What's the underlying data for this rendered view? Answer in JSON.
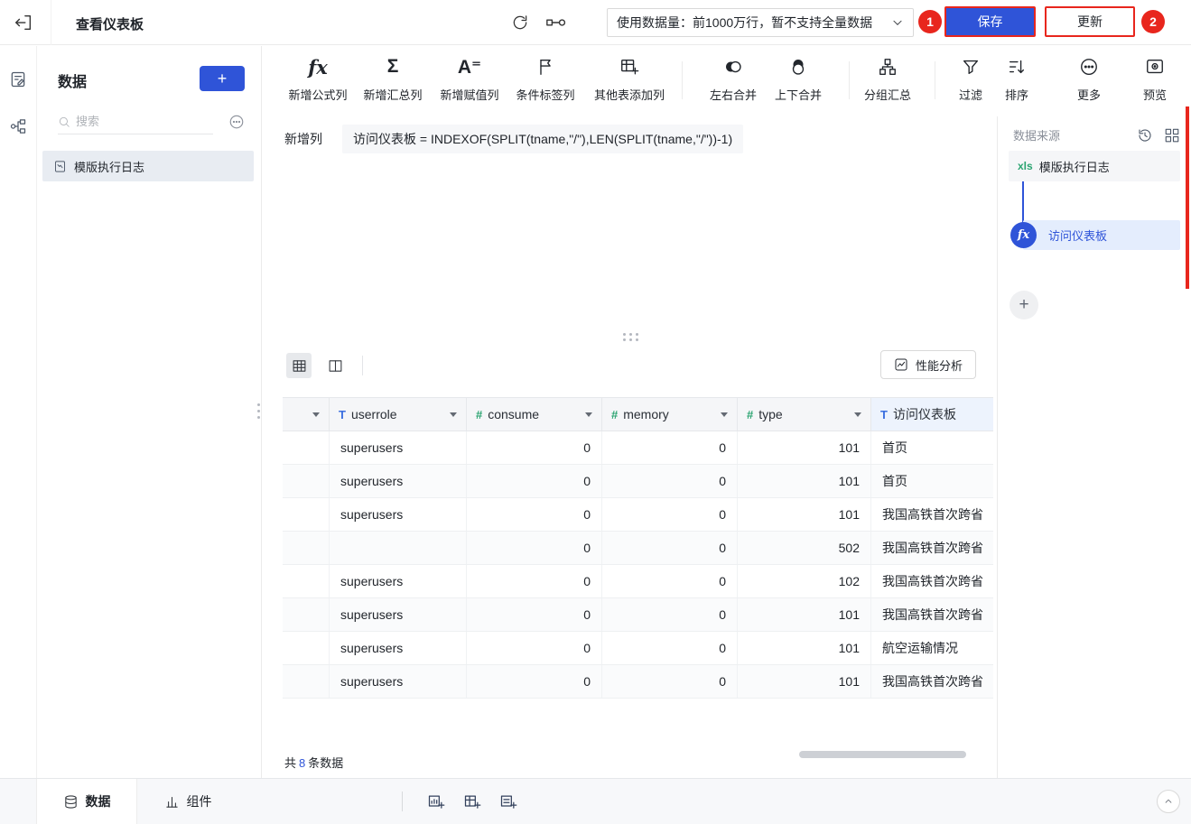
{
  "topbar": {
    "exit_icon": "exit-icon",
    "title": "查看仪表板",
    "refresh_icon": "refresh-icon",
    "flow_icon": "flow-icon",
    "data_limit_label": "使用数据量：前1000万行，暂不支持全量数据",
    "save_label": "保存",
    "update_label": "更新",
    "annotation_badge_1": "1",
    "annotation_badge_2": "2"
  },
  "left_rail": {
    "icons": [
      "data-edit-icon",
      "relation-icon"
    ]
  },
  "left_panel": {
    "title": "数据",
    "add_button": "+",
    "search_placeholder": "搜索",
    "more_icon": "ellipsis-circle-icon",
    "list": [
      {
        "icon": "log-table-icon",
        "label": "模版执行日志"
      }
    ]
  },
  "toolbar": {
    "items": [
      {
        "icon": "formula-icon",
        "glyph": "fx",
        "label": "新增公式列"
      },
      {
        "icon": "sigma-icon",
        "glyph": "Σ",
        "label": "新增汇总列"
      },
      {
        "icon": "assign-icon",
        "glyph": "A⁼",
        "label": "新增赋值列"
      },
      {
        "icon": "flag-icon",
        "label": "条件标签列"
      },
      {
        "icon": "table-add-icon",
        "label": "其他表添加列"
      },
      {
        "icon": "merge-horizontal-icon",
        "label": "左右合并"
      },
      {
        "icon": "merge-vertical-icon",
        "label": "上下合并"
      },
      {
        "icon": "group-summary-icon",
        "label": "分组汇总"
      },
      {
        "icon": "filter-icon",
        "label": "过滤"
      },
      {
        "icon": "sort-icon",
        "label": "排序"
      },
      {
        "icon": "more-icon",
        "label": "更多"
      },
      {
        "icon": "preview-icon",
        "label": "预览"
      }
    ]
  },
  "formula_bar": {
    "label": "新增列",
    "expression": "访问仪表板 = INDEXOF(SPLIT(tname,\"/\"),LEN(SPLIT(tname,\"/\"))-1)"
  },
  "table_section": {
    "view_icons": [
      "grid-view-icon",
      "column-view-icon"
    ],
    "performance_label": "性能分析",
    "type_icons": {
      "text": "T",
      "number": "#"
    },
    "columns": [
      {
        "name": "",
        "type": ""
      },
      {
        "name": "userrole",
        "type": "text"
      },
      {
        "name": "consume",
        "type": "number"
      },
      {
        "name": "memory",
        "type": "number"
      },
      {
        "name": "type",
        "type": "number"
      },
      {
        "name": "访问仪表板",
        "type": "text"
      }
    ],
    "rows": [
      {
        "userrole": "superusers",
        "consume": "0",
        "memory": "0",
        "type": "101",
        "dashboard": "首页"
      },
      {
        "userrole": "superusers",
        "consume": "0",
        "memory": "0",
        "type": "101",
        "dashboard": "首页"
      },
      {
        "userrole": "superusers",
        "consume": "0",
        "memory": "0",
        "type": "101",
        "dashboard": "我国高铁首次跨省"
      },
      {
        "userrole": "",
        "consume": "0",
        "memory": "0",
        "type": "502",
        "dashboard": "我国高铁首次跨省"
      },
      {
        "userrole": "superusers",
        "consume": "0",
        "memory": "0",
        "type": "102",
        "dashboard": "我国高铁首次跨省"
      },
      {
        "userrole": "superusers",
        "consume": "0",
        "memory": "0",
        "type": "101",
        "dashboard": "我国高铁首次跨省"
      },
      {
        "userrole": "superusers",
        "consume": "0",
        "memory": "0",
        "type": "101",
        "dashboard": "航空运输情况"
      },
      {
        "userrole": "superusers",
        "consume": "0",
        "memory": "0",
        "type": "101",
        "dashboard": "我国高铁首次跨省"
      }
    ],
    "footer": {
      "prefix": "共",
      "count": "8",
      "suffix": "条数据"
    }
  },
  "right_panel": {
    "title": "数据来源",
    "header_icons": [
      "history-icon",
      "layout-icon"
    ],
    "source_node": {
      "badge": "xls",
      "label": "模版执行日志"
    },
    "formula_node": {
      "icon_text": "fx",
      "label": "访问仪表板"
    },
    "add_button": "+"
  },
  "bottom_bar": {
    "tabs": [
      {
        "icon": "database-icon",
        "label": "数据",
        "active": true
      },
      {
        "icon": "chart-icon",
        "label": "组件",
        "active": false
      }
    ],
    "quick_icons": [
      "add-chart-icon",
      "add-pivot-icon",
      "add-list-icon"
    ],
    "collapse_icon": "chevron-up-icon"
  },
  "colors": {
    "primary_blue": "#2f54d8",
    "annotation_red": "#e8261d",
    "numeric_green": "#2ba471",
    "text_type_blue": "#3b6fe0"
  }
}
